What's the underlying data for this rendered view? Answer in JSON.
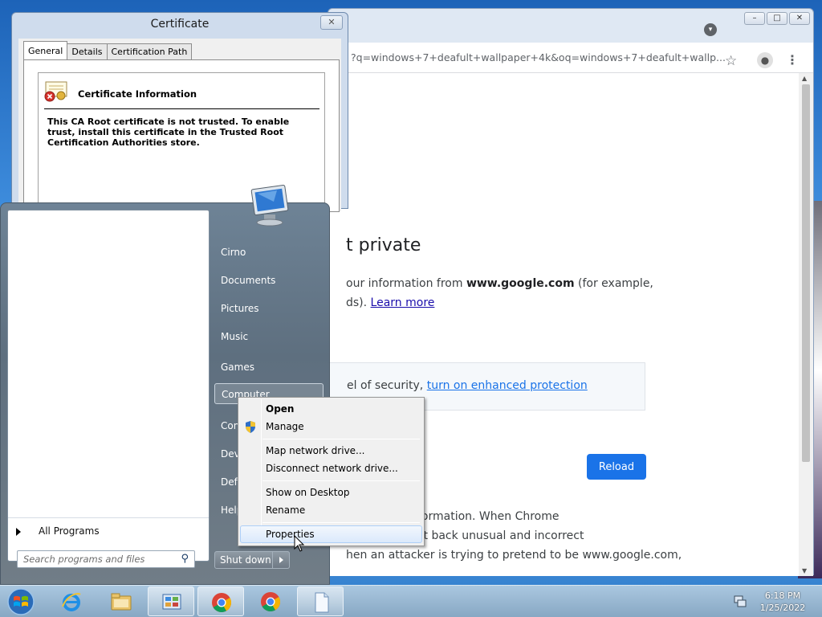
{
  "certificate": {
    "title": "Certificate",
    "close_glyph": "✕",
    "tabs": [
      {
        "label": "General",
        "active": true
      },
      {
        "label": "Details",
        "active": false
      },
      {
        "label": "Certification Path",
        "active": false
      }
    ],
    "info_title": "Certificate Information",
    "message": "This CA Root certificate is not trusted. To enable trust, install this certificate in the Trusted Root Certification Authorities store.",
    "icon": "certificate-error-icon"
  },
  "chrome": {
    "window_buttons": [
      "–",
      "□",
      "✕"
    ],
    "url": "?q=windows+7+deafult+wallpaper+4k&oq=windows+7+deafult+wallp...",
    "page": {
      "heading": "t private",
      "para1_start": "our information from ",
      "para1_domain": "www.google.com",
      "para1_end": " (for example,",
      "para1_line2": "ds). ",
      "learn_more": "Learn more",
      "security_text": "el of security, ",
      "security_link": "turn on enhanced protection",
      "reload_label": "Reload",
      "para2_lines": [
        "otect your information. When Chrome",
        "e website sent back unusual and incorrect",
        "hen an attacker is trying to pretend to be www.google.com,"
      ]
    }
  },
  "start_menu": {
    "right_items": [
      {
        "label": "Cirno",
        "name": "start-item-cirno"
      },
      {
        "label": "Documents",
        "name": "start-item-documents"
      },
      {
        "label": "Pictures",
        "name": "start-item-pictures"
      },
      {
        "label": "Music",
        "name": "start-item-music"
      },
      {
        "label": "Games",
        "name": "start-item-games"
      },
      {
        "label": "Computer",
        "name": "start-item-computer"
      },
      {
        "label": "Con",
        "name": "start-item-control-panel"
      },
      {
        "label": "Devi",
        "name": "start-item-devices"
      },
      {
        "label": "Defa",
        "name": "start-item-default-programs"
      },
      {
        "label": "Help",
        "name": "start-item-help"
      }
    ],
    "all_programs": "All Programs",
    "search_placeholder": "Search programs and files",
    "shutdown_label": "Shut down"
  },
  "context_menu": {
    "items": [
      {
        "label": "Open",
        "bold": true
      },
      {
        "label": "Manage",
        "icon": "uac-shield-icon"
      },
      {
        "label": "Map network drive..."
      },
      {
        "label": "Disconnect network drive..."
      },
      {
        "label": "Show on Desktop"
      },
      {
        "label": "Rename"
      },
      {
        "label": "Properties",
        "hover": true
      }
    ]
  },
  "taskbar": {
    "pinned": [
      "internet-explorer-icon",
      "windows-explorer-icon",
      "control-panel-icon",
      "chrome-icon",
      "chrome-icon",
      "document-icon"
    ],
    "clock_time": "6:18 PM",
    "clock_date": "1/25/2022"
  }
}
